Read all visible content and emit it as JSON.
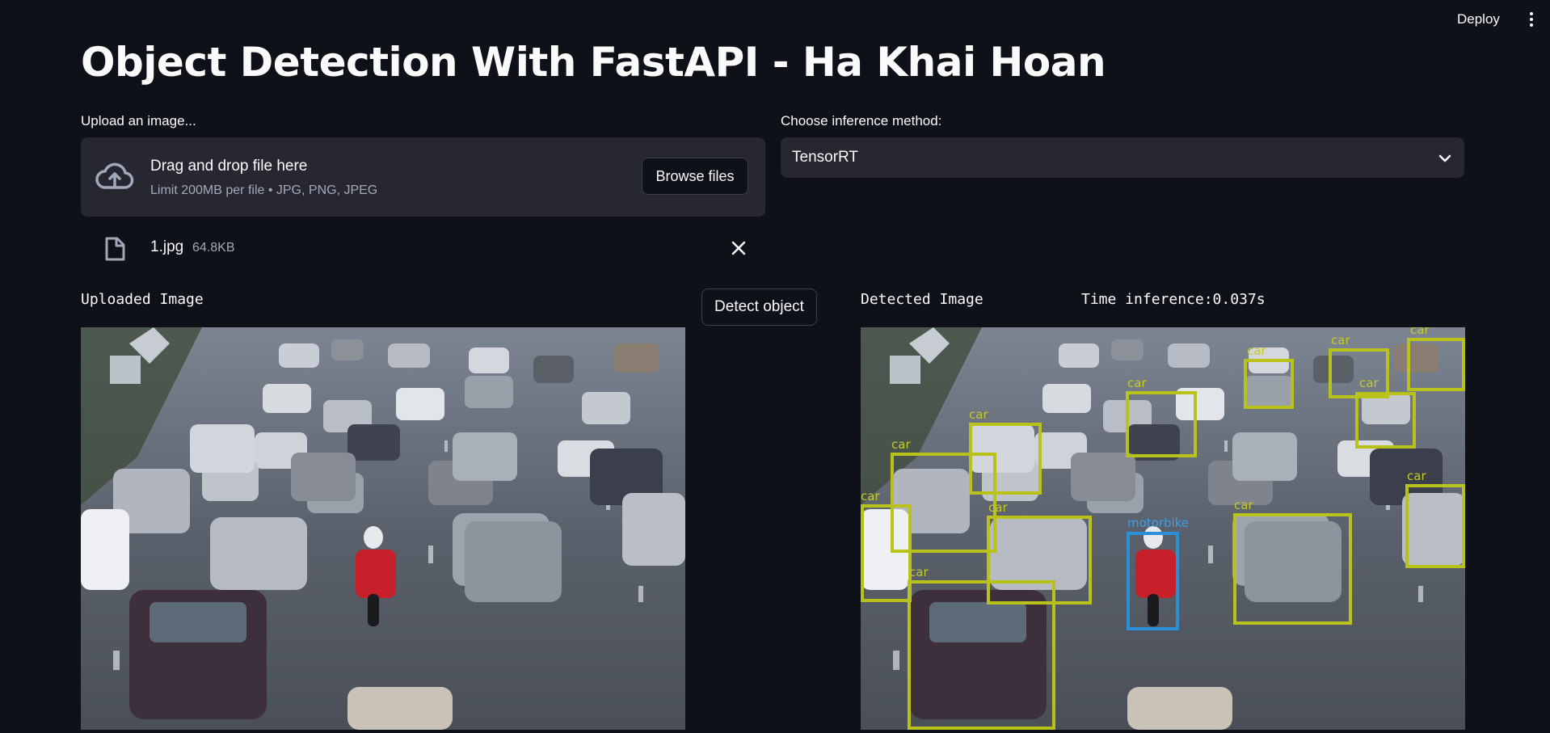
{
  "header": {
    "deploy_label": "Deploy",
    "menu_icon": "kebab-menu-icon"
  },
  "page": {
    "title": "Object Detection With FastAPI - Ha Khai Hoan"
  },
  "uploader": {
    "label": "Upload an image...",
    "drop_title": "Drag and drop file here",
    "drop_limit": "Limit 200MB per file • JPG, PNG, JPEG",
    "browse_label": "Browse files",
    "icon": "cloud-upload-icon",
    "file": {
      "name": "1.jpg",
      "size": "64.8KB",
      "icon": "file-icon",
      "remove_icon": "close-icon"
    }
  },
  "inference": {
    "label": "Choose inference method:",
    "selected": "TensorRT",
    "icon": "chevron-down-icon"
  },
  "uploaded": {
    "label": "Uploaded Image"
  },
  "detect_button": "Detect object",
  "detected": {
    "label": "Detected Image",
    "time_label": "Time inference:0.037s",
    "box_color": "#b9c21a",
    "motorbike_color": "#2a8fd6",
    "detections": [
      {
        "label": "car"
      },
      {
        "label": "car"
      },
      {
        "label": "car"
      },
      {
        "label": "car"
      },
      {
        "label": "car"
      },
      {
        "label": "car"
      },
      {
        "label": "car"
      },
      {
        "label": "car"
      },
      {
        "label": "car"
      },
      {
        "label": "car"
      },
      {
        "label": "car"
      },
      {
        "label": "car"
      },
      {
        "label": "car"
      },
      {
        "label": "motorbike"
      }
    ]
  }
}
